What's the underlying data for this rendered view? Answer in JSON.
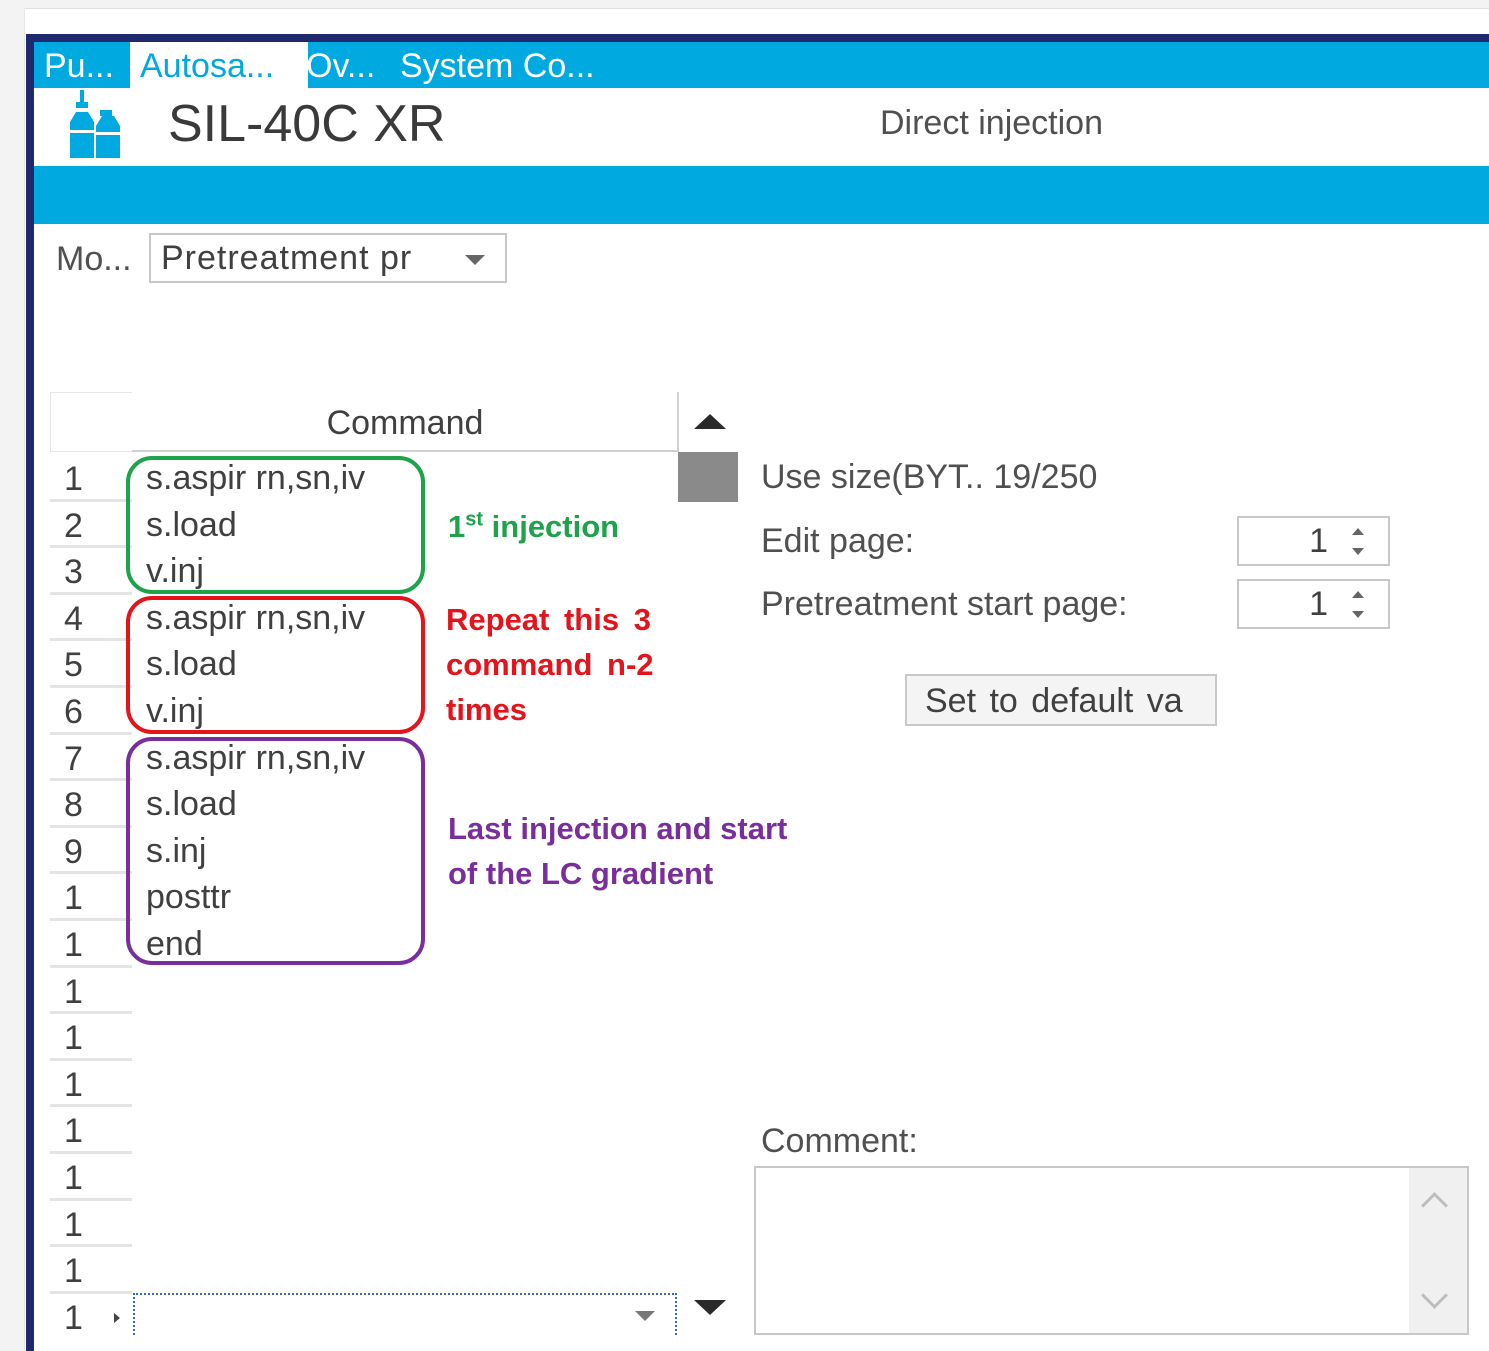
{
  "tabs": [
    {
      "label": "Pu..."
    },
    {
      "label": "Autosa..."
    },
    {
      "label": "Ov..."
    },
    {
      "label": "System Co..."
    }
  ],
  "header": {
    "model": "SIL-40C XR",
    "mode_text": "Direct injection"
  },
  "mode": {
    "label": "Mo...",
    "value": "Pretreatment pr"
  },
  "grid": {
    "column_header": "Command",
    "rows": [
      {
        "num": "1",
        "command": "s.aspir rn,sn,iv"
      },
      {
        "num": "2",
        "command": "s.load"
      },
      {
        "num": "3",
        "command": "v.inj"
      },
      {
        "num": "4",
        "command": "s.aspir rn,sn,iv"
      },
      {
        "num": "5",
        "command": "s.load"
      },
      {
        "num": "6",
        "command": "v.inj"
      },
      {
        "num": "7",
        "command": "s.aspir rn,sn,iv"
      },
      {
        "num": "8",
        "command": "s.load"
      },
      {
        "num": "9",
        "command": "s.inj"
      },
      {
        "num": "1",
        "command": "posttr"
      },
      {
        "num": "1",
        "command": "end"
      },
      {
        "num": "1",
        "command": ""
      },
      {
        "num": "1",
        "command": ""
      },
      {
        "num": "1",
        "command": ""
      },
      {
        "num": "1",
        "command": ""
      },
      {
        "num": "1",
        "command": ""
      },
      {
        "num": "1",
        "command": ""
      },
      {
        "num": "1",
        "command": ""
      },
      {
        "num": "1",
        "command": ""
      }
    ]
  },
  "annotations": {
    "first_number": "1",
    "first_sup": "st",
    "first_rest": " injection",
    "repeat_lines": [
      "Repeat this 3",
      "command n-2",
      "times"
    ],
    "last_lines": [
      "Last injection and start",
      "of the LC gradient"
    ],
    "colors": {
      "green": "#1da34a",
      "red": "#e3141b",
      "purple": "#7a2e9b"
    }
  },
  "panel": {
    "use_size": "Use size(BYT.. 19/250",
    "edit_page_label": "Edit page:",
    "edit_page_value": "1",
    "start_page_label": "Pretreatment start page:",
    "start_page_value": "1",
    "default_button": "Set to default va",
    "comment_label": "Comment:",
    "comment_value": ""
  },
  "colors": {
    "accent": "#00a9e0",
    "frame": "#1f2a6e"
  }
}
